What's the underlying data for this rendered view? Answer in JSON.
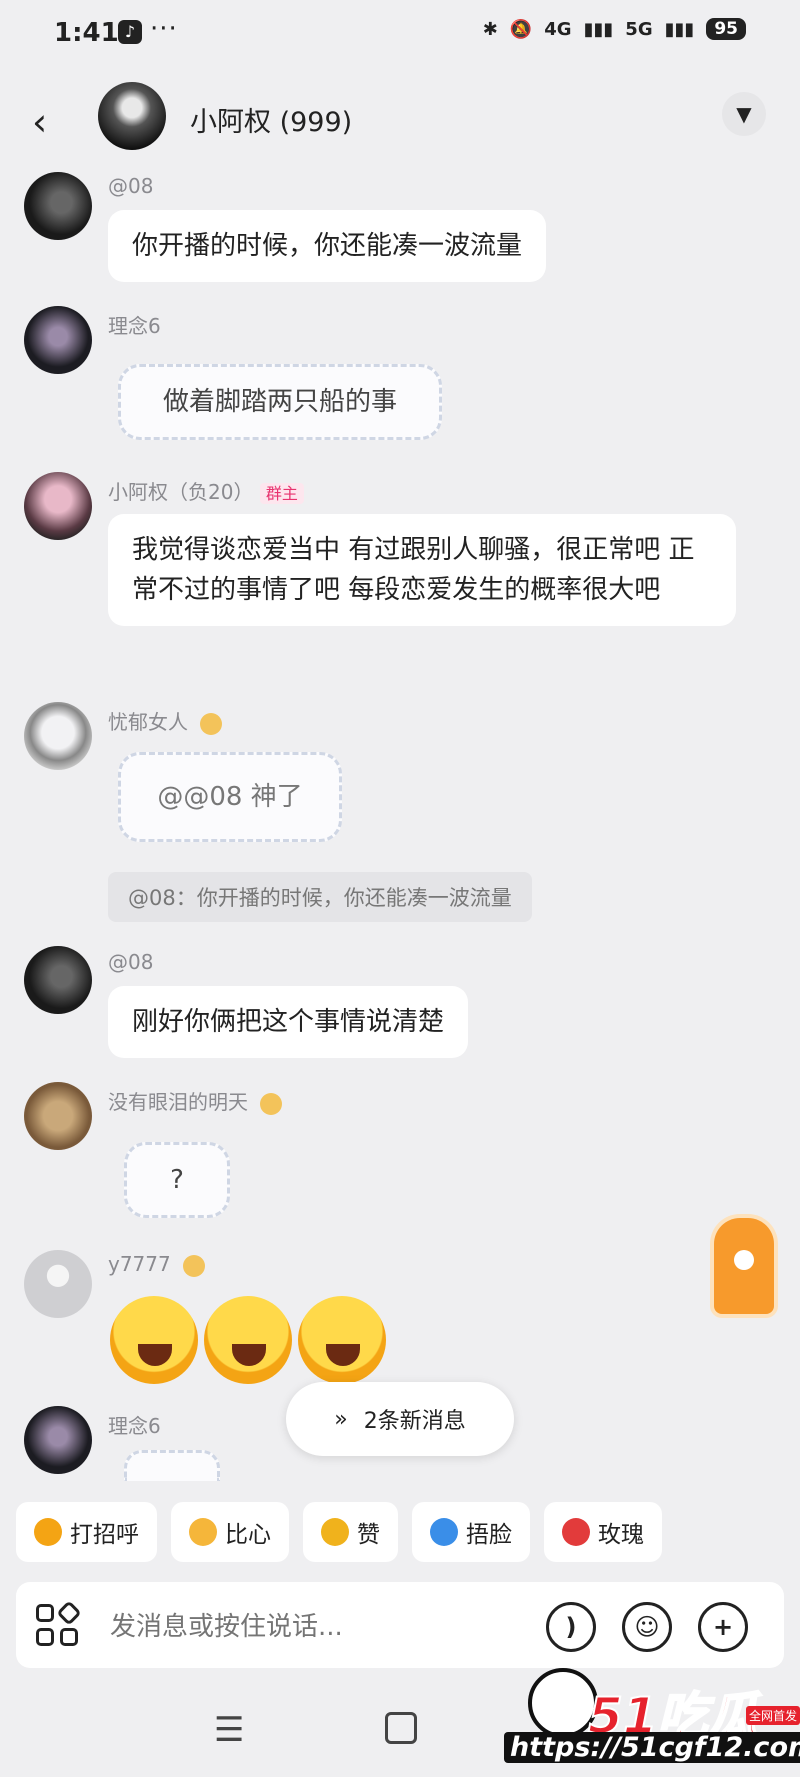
{
  "status_bar": {
    "time": "1:41",
    "dots": "···",
    "network1": "4G",
    "network2": "5G",
    "battery": "95"
  },
  "header": {
    "title": "小阿权 (999)"
  },
  "messages": [
    {
      "sender": "@08",
      "text": "你开播的时候，你还能凑一波流量"
    },
    {
      "sender": "理念6",
      "sticker_text": "做着脚踏两只船的事"
    },
    {
      "sender": "小阿权（负20）",
      "tag": "群主",
      "text": "我觉得谈恋爱当中 有过跟别人聊骚，很正常吧 正常不过的事情了吧 每段恋爱发生的概率很大吧"
    },
    {
      "sender": "忧郁女人",
      "sticker_text": "@@08 神了",
      "quote": "@08：你开播的时候，你还能凑一波流量"
    },
    {
      "sender": "@08",
      "text": "刚好你俩把这个事情说清楚"
    },
    {
      "sender": "没有眼泪的明天",
      "sticker_text": "?"
    },
    {
      "sender": "y7777"
    },
    {
      "sender": "理念6"
    }
  ],
  "new_messages": {
    "label": "2条新消息"
  },
  "quick_replies": [
    {
      "label": "打招呼",
      "color": "#f4a414"
    },
    {
      "label": "比心",
      "color": "#f5b63a"
    },
    {
      "label": "赞",
      "color": "#f0b21c"
    },
    {
      "label": "捂脸",
      "color": "#3a8ee8"
    },
    {
      "label": "玫瑰",
      "color": "#e23b3b"
    }
  ],
  "input": {
    "placeholder": "发消息或按住说话..."
  },
  "icons": {
    "voice": "voice-icon",
    "emoji": "emoji-face-icon",
    "plus": "plus-icon",
    "apps": "apps-grid-icon"
  },
  "watermark": {
    "logo": "51吃瓜",
    "tag": "全网首发",
    "url": "https://51cgf12.com"
  },
  "colors": {
    "background": "#efeff1",
    "bubble": "#ffffff",
    "owner_tag": "#e8336f",
    "accent": "#f79a2c"
  }
}
